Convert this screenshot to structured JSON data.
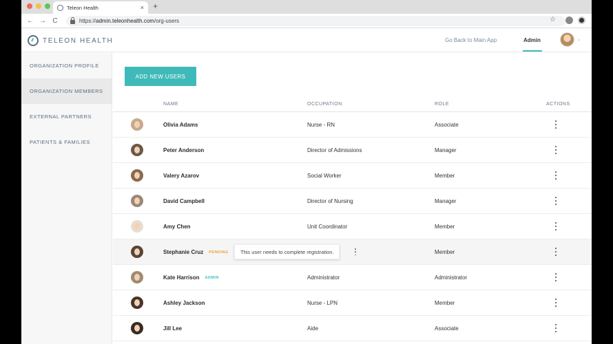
{
  "browser": {
    "tab_title": "Teleon Health",
    "tab_close": "×",
    "new_tab": "+",
    "url_scheme": "https://",
    "url_host": "admin.teleonhealth.com",
    "url_path": "/org-users",
    "back": "←",
    "forward": "→",
    "reload": "C",
    "star": "☆"
  },
  "header": {
    "brand": "TELEON HEALTH",
    "go_back": "Go Back to Main App",
    "admin": "Admin",
    "chevron": "⌄"
  },
  "sidebar": {
    "items": [
      {
        "label": "ORGANIZATION PROFILE"
      },
      {
        "label": "ORGANIZATION MEMBERS"
      },
      {
        "label": "EXTERNAL PARTNERS"
      },
      {
        "label": "PATIENTS & FAMILIES"
      }
    ]
  },
  "main": {
    "add_button": "ADD NEW USERS",
    "columns": {
      "name": "NAME",
      "occupation": "OCCUPATION",
      "role": "ROLE",
      "actions": "ACTIONS"
    },
    "rows": [
      {
        "name": "Olivia Adams",
        "occupation": "Nurse - RN",
        "role": "Associate",
        "badge": ""
      },
      {
        "name": "Peter Anderson",
        "occupation": "Director of Admissions",
        "role": "Manager",
        "badge": ""
      },
      {
        "name": "Valery Azarov",
        "occupation": "Social Worker",
        "role": "Member",
        "badge": ""
      },
      {
        "name": "David Campbell",
        "occupation": "Director of Nursing",
        "role": "Manager",
        "badge": ""
      },
      {
        "name": "Amy Chen",
        "occupation": "Unit Coordinator",
        "role": "Member",
        "badge": ""
      },
      {
        "name": "Stephanie Cruz",
        "occupation": "",
        "role": "Member",
        "badge": "PENDING"
      },
      {
        "name": "Kate Harrison",
        "occupation": "Administrator",
        "role": "Administrator",
        "badge": "ADMIN"
      },
      {
        "name": "Ashley Jackson",
        "occupation": "Nurse - LPN",
        "role": "Member",
        "badge": ""
      },
      {
        "name": "Jill Lee",
        "occupation": "Aide",
        "role": "Associate",
        "badge": ""
      }
    ],
    "tooltip": "This user needs to complete registration."
  },
  "colors": {
    "accent": "#3fbab8",
    "pending": "#e6a23c",
    "text_muted": "#5b6c7f"
  }
}
